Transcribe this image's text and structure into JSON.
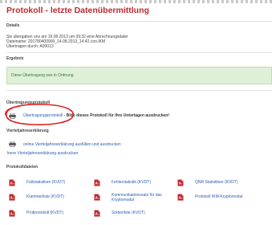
{
  "title": "Protokoll - letzte Datenübermittlung",
  "details": {
    "heading": "Details",
    "line1": "Sie übergaben uns am 19.08.2013 um 09:32 eine Abrechnungsdatei",
    "line2": "Dateiname: 201780400900_14.08.2013_14:42.con.IKM",
    "line3": "Übertragen durch: A00013"
  },
  "ergebnis": {
    "heading": "Ergebnis",
    "message": "Diese Übertragung war in Ordnung"
  },
  "uebertragungsprotokoll": {
    "heading": "Übertragungsprotokoll",
    "link": "Übertragungsprotokoll",
    "note": " - Bitte dieses Protokoll für Ihre Unterlagen ausdrucken!"
  },
  "vierteljahreserklaerung": {
    "heading": "Vierteljahreserklärung",
    "fill_link": "online Vierteljahreserklärung ausfüllen und ausdrucken",
    "blank_link": "leere Vierteljahreserklärung ausdrucken"
  },
  "protokolldateien": {
    "heading": "Protokolldateien",
    "files": [
      [
        "Fallstatistiken (KVDT)"
      ],
      [
        "Fehlerstatistik (KVDT)"
      ],
      [
        "QNR Statistiken (KVDT)"
      ],
      [
        "Klammerliste (KVDT)"
      ],
      [
        "Kommunikationssatz für das",
        "Kryptomodul"
      ],
      [
        "Protokoll IKM-Kryptomodul"
      ],
      [
        "Prüfprotokoll (KVDT)"
      ],
      [
        "Sortierliste (KVDT)"
      ]
    ]
  },
  "icons": {
    "printer": "printer-icon",
    "pdf": "pdf-icon"
  },
  "colors": {
    "title_red": "#c0282d",
    "link_blue": "#2a5db0",
    "success_bg": "#dff0d8",
    "success_text": "#3c763d",
    "annotation_red": "#e02020"
  }
}
